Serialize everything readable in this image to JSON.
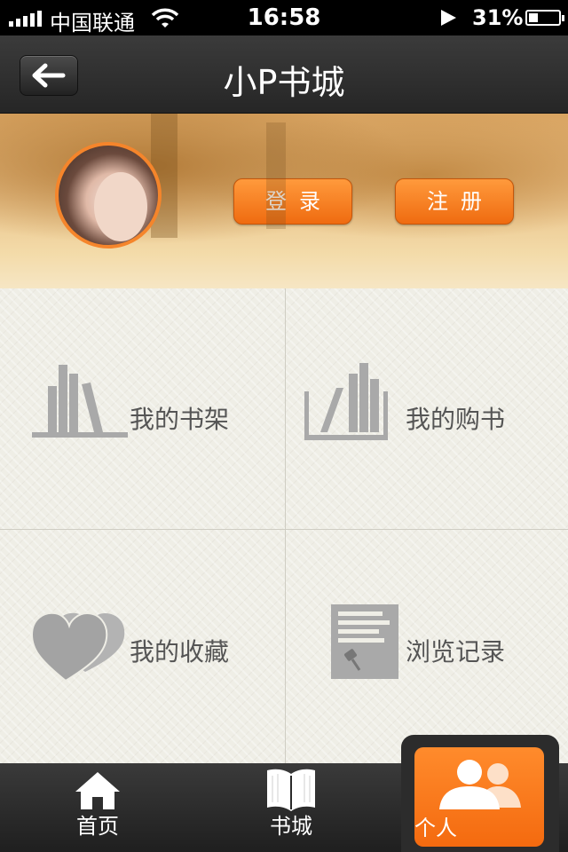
{
  "status_bar": {
    "carrier": "中国联通",
    "time": "16:58",
    "battery_percent": "31%",
    "battery_level": 0.31
  },
  "nav": {
    "title": "小P书城",
    "back_icon": "back-arrow-icon"
  },
  "profile": {
    "login_label": "登录",
    "register_label": "注册"
  },
  "menu": [
    {
      "label": "我的书架",
      "icon": "bookshelf-icon"
    },
    {
      "label": "我的购书",
      "icon": "book-purchase-icon"
    },
    {
      "label": "我的收藏",
      "icon": "heart-icon"
    },
    {
      "label": "浏览记录",
      "icon": "history-note-icon"
    }
  ],
  "tab_bar": {
    "items": [
      {
        "label": "首页",
        "icon": "home-icon"
      },
      {
        "label": "书城",
        "icon": "book-icon"
      },
      {
        "label": "个人",
        "icon": "users-icon"
      }
    ],
    "active_index": 2
  },
  "colors": {
    "accent": "#f47418",
    "nav_background": "#2e2e2e",
    "menu_text": "#555555",
    "icon_gray": "#a9a9a9"
  }
}
